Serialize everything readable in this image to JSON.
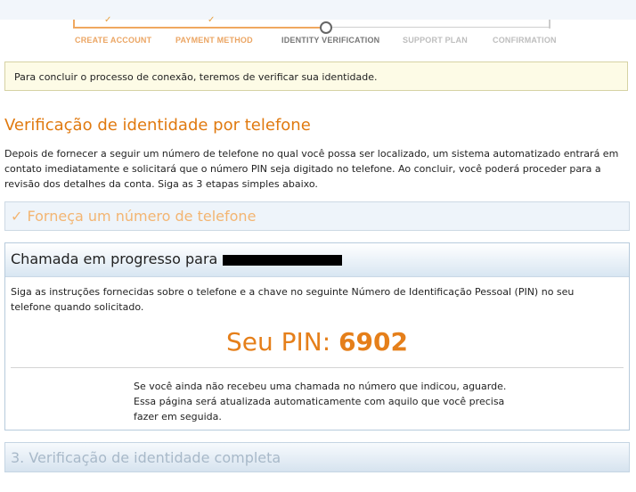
{
  "steps": [
    {
      "label": "CREATE ACCOUNT",
      "state": "done"
    },
    {
      "label": "PAYMENT METHOD",
      "state": "done"
    },
    {
      "label": "IDENTITY VERIFICATION",
      "state": "active"
    },
    {
      "label": "SUPPORT PLAN",
      "state": "todo"
    },
    {
      "label": "CONFIRMATION",
      "state": "todo"
    }
  ],
  "check_glyph": "✓",
  "notice": "Para concluir o processo de conexão, teremos de verificar sua identidade.",
  "heading": "Verificação de identidade por telefone",
  "description": "Depois de fornecer a seguir um número de telefone no qual você possa ser localizado, um sistema automatizado entrará em contato imediatamente e solicitará que o número PIN seja digitado no telefone. Ao concluir, você poderá proceder para a revisão dos detalhes da conta. Siga as 3 etapas simples abaixo.",
  "step1": {
    "check": "✓",
    "title": "Forneça um número de telefone"
  },
  "step2": {
    "title": "Chamada em progresso para",
    "instructions": "Siga as instruções fornecidas sobre o telefone e a chave no seguinte Número de Identificação Pessoal (PIN) no seu telefone quando solicitado.",
    "pin_label": "Seu PIN:",
    "pin_value": "6902",
    "waiting": "Se você ainda não recebeu uma chamada no número que indicou, aguarde. Essa página será atualizada automaticamente com aquilo que você precisa fazer em seguida."
  },
  "step3": {
    "title": "3. Verificação de identidade completa"
  },
  "colors": {
    "accent": "#e07a10",
    "done_step": "#f0a860",
    "panel_bg": "#eef4fa"
  }
}
